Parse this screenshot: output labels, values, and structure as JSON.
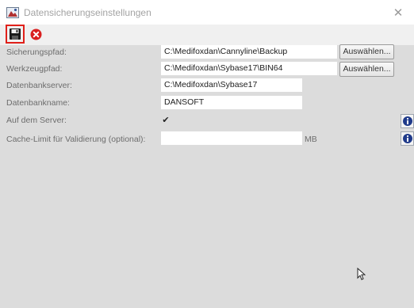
{
  "window": {
    "title": "Datensicherungseinstellungen"
  },
  "toolbar": {
    "save_icon": "floppy-disk-icon",
    "cancel_icon": "red-x-icon"
  },
  "form": {
    "backup_path": {
      "label": "Sicherungspfad:",
      "value": "C:\\Medifoxdan\\Cannyline\\Backup",
      "browse": "Auswählen..."
    },
    "tool_path": {
      "label": "Werkzeugpfad:",
      "value": "C:\\Medifoxdan\\Sybase17\\BIN64",
      "browse": "Auswählen..."
    },
    "db_server": {
      "label": "Datenbankserver:",
      "value": "C:\\Medifoxdan\\Sybase17"
    },
    "db_name": {
      "label": "Datenbankname:",
      "value": "DANSOFT"
    },
    "on_server": {
      "label": "Auf dem Server:",
      "checked": true
    },
    "cache_limit": {
      "label": "Cache-Limit für Validierung (optional):",
      "value": "",
      "unit": "MB"
    }
  },
  "colors": {
    "highlight_border": "#e0201a",
    "panel_bg": "#dcdcdc",
    "info_icon": "#1f3a8a"
  }
}
